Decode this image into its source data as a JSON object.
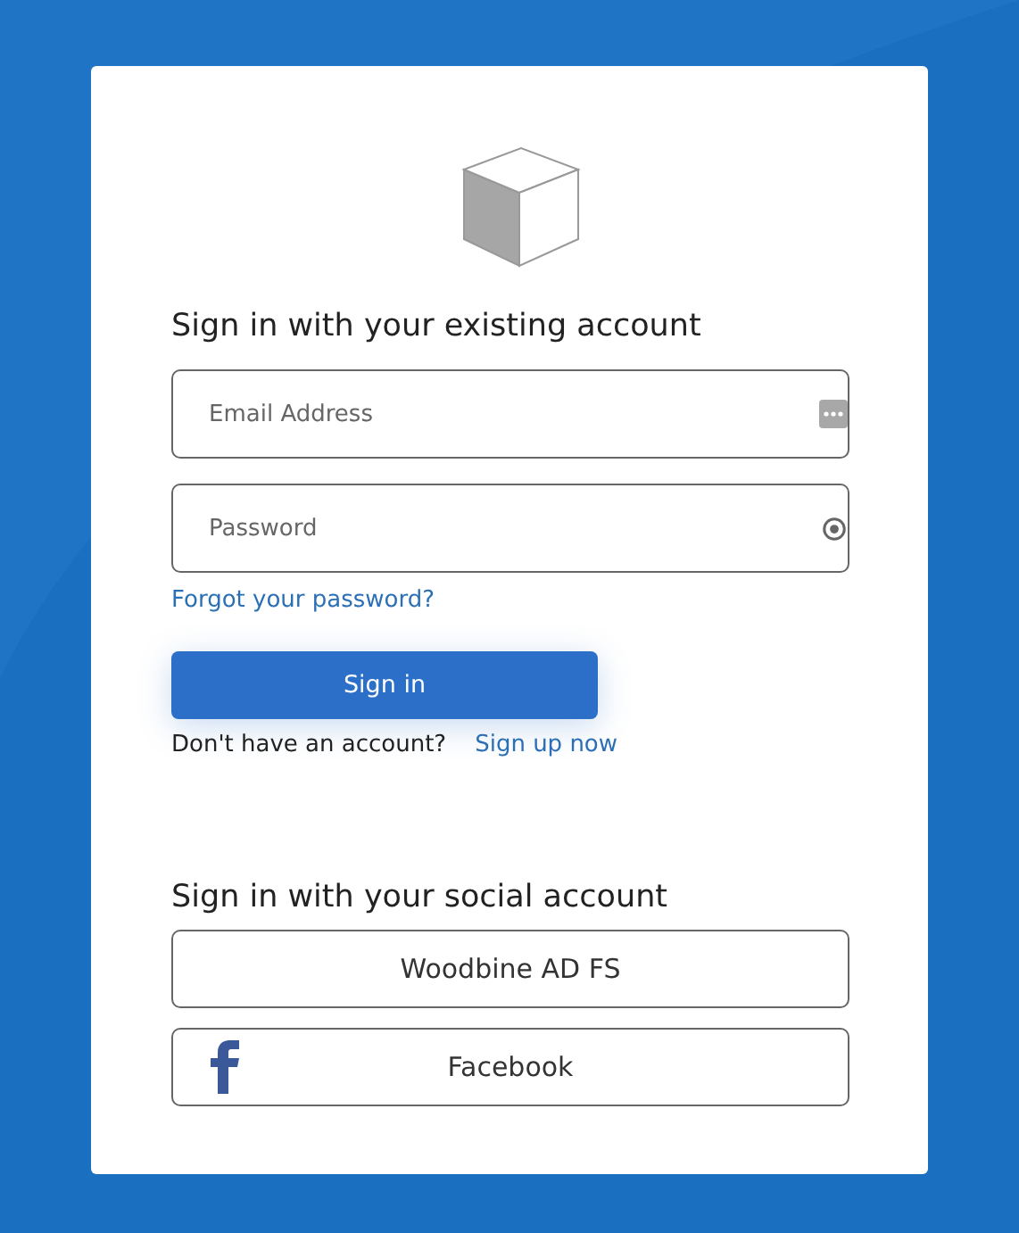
{
  "local": {
    "heading": "Sign in with your existing account",
    "fields": [
      {
        "placeholder": "Email Address",
        "kind": "email"
      },
      {
        "placeholder": "Password",
        "kind": "password"
      }
    ],
    "forgot_link": "Forgot your password?",
    "submit": "Sign in",
    "signup_prompt": "Don't have an account?",
    "signup_link": "Sign up now"
  },
  "social": {
    "heading": "Sign in with your social account",
    "providers": [
      {
        "label": "Woodbine AD FS",
        "kind": "plain"
      },
      {
        "label": "Facebook",
        "kind": "facebook"
      }
    ]
  }
}
